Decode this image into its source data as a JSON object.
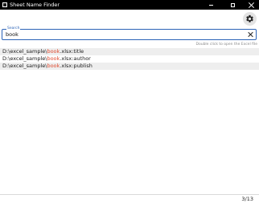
{
  "window": {
    "title": "Sheet Name Finder"
  },
  "icons": {
    "app": "app-icon",
    "settings": "gear-icon",
    "clear": "close-icon"
  },
  "search": {
    "label": "Search",
    "value": "book",
    "hint": "Double click to open the Excel file"
  },
  "results": [
    {
      "path": "D:\\excel_sample\\",
      "match": "book",
      "suffix": ".xlsx:title"
    },
    {
      "path": "D:\\excel_sample\\",
      "match": "book",
      "suffix": ".xlsx:author"
    },
    {
      "path": "D:\\excel_sample\\",
      "match": "book",
      "suffix": ".xlsx:publish"
    }
  ],
  "status": {
    "page": "3/13"
  },
  "colors": {
    "accent": "#2b63b7",
    "match": "#e04a2f",
    "titlebar": "#000000"
  }
}
